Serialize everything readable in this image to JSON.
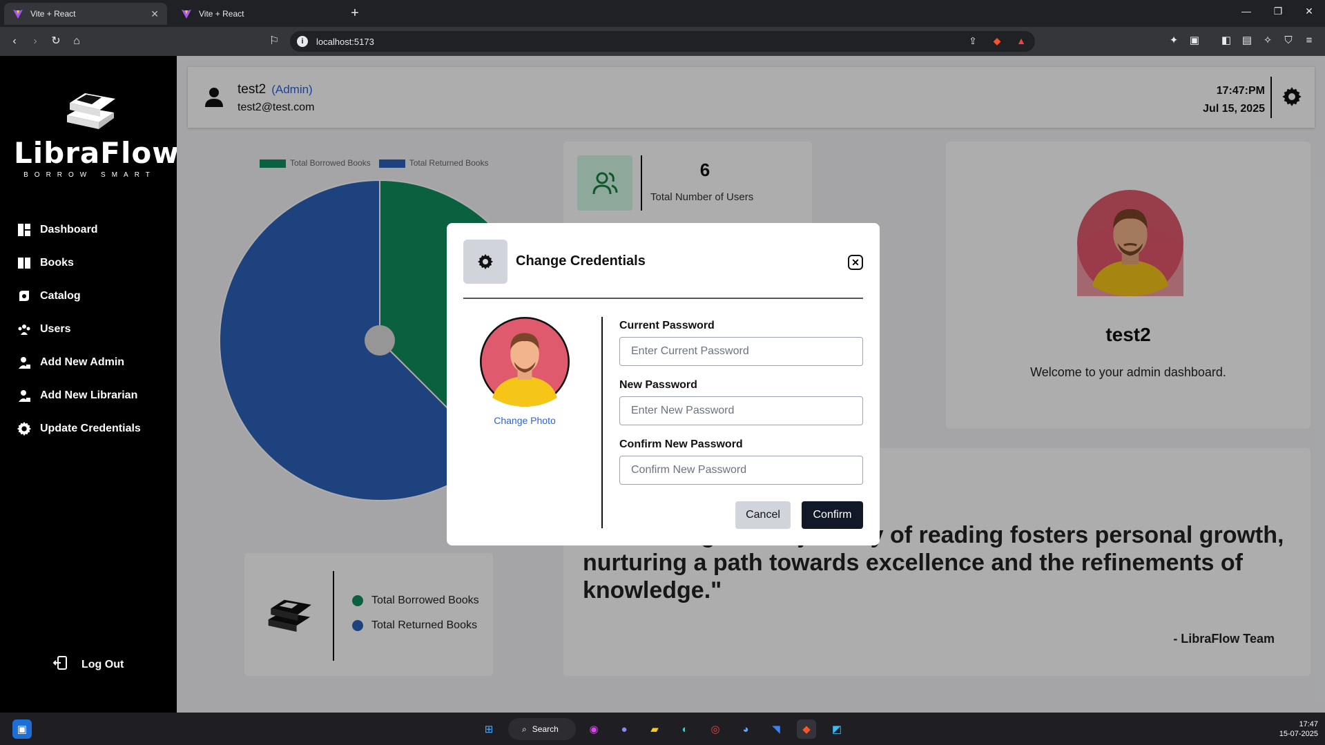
{
  "browser": {
    "tabs": [
      {
        "title": "Vite + React",
        "active": true
      },
      {
        "title": "Vite + React",
        "active": false
      }
    ],
    "url": "localhost:5173"
  },
  "sidebar": {
    "brand": "LibraFlow",
    "tagline": "BORROW SMART",
    "items": [
      {
        "label": "Dashboard",
        "icon": "dashboard-icon"
      },
      {
        "label": "Books",
        "icon": "book-icon"
      },
      {
        "label": "Catalog",
        "icon": "catalog-icon"
      },
      {
        "label": "Users",
        "icon": "users-icon"
      },
      {
        "label": "Add New Admin",
        "icon": "add-admin-icon"
      },
      {
        "label": "Add New Librarian",
        "icon": "add-librarian-icon"
      },
      {
        "label": "Update Credentials",
        "icon": "gear-icon"
      }
    ],
    "logout": "Log Out"
  },
  "header": {
    "username": "test2",
    "role": "(Admin)",
    "email": "test2@test.com",
    "time": "17:47:PM",
    "date": "Jul 15, 2025"
  },
  "chart_data": {
    "type": "pie",
    "legend": [
      "Total Borrowed Books",
      "Total Returned Books"
    ],
    "values": [
      6,
      10
    ],
    "colors": [
      "#0e8f5e",
      "#2d62b8"
    ]
  },
  "stats": {
    "users_count": "6",
    "users_label": "Total Number of Users"
  },
  "profile": {
    "name": "test2",
    "message": "Welcome to your admin dashboard."
  },
  "legend_card": {
    "borrowed": "Total Borrowed Books",
    "returned": "Total Returned Books"
  },
  "quote": {
    "text": "\"Embarking on the journey of reading fosters personal growth, nurturing a path towards excellence and the refinements of knowledge.\"",
    "author": "- LibraFlow Team"
  },
  "modal": {
    "title": "Change Credentials",
    "change_photo": "Change Photo",
    "current_label": "Current Password",
    "current_placeholder": "Enter Current Password",
    "new_label": "New Password",
    "new_placeholder": "Enter New Password",
    "confirm_label": "Confirm New Password",
    "confirm_placeholder": "Confirm New Password",
    "cancel": "Cancel",
    "confirm": "Confirm"
  },
  "taskbar": {
    "search": "Search",
    "time": "17:47",
    "date": "15-07-2025"
  }
}
